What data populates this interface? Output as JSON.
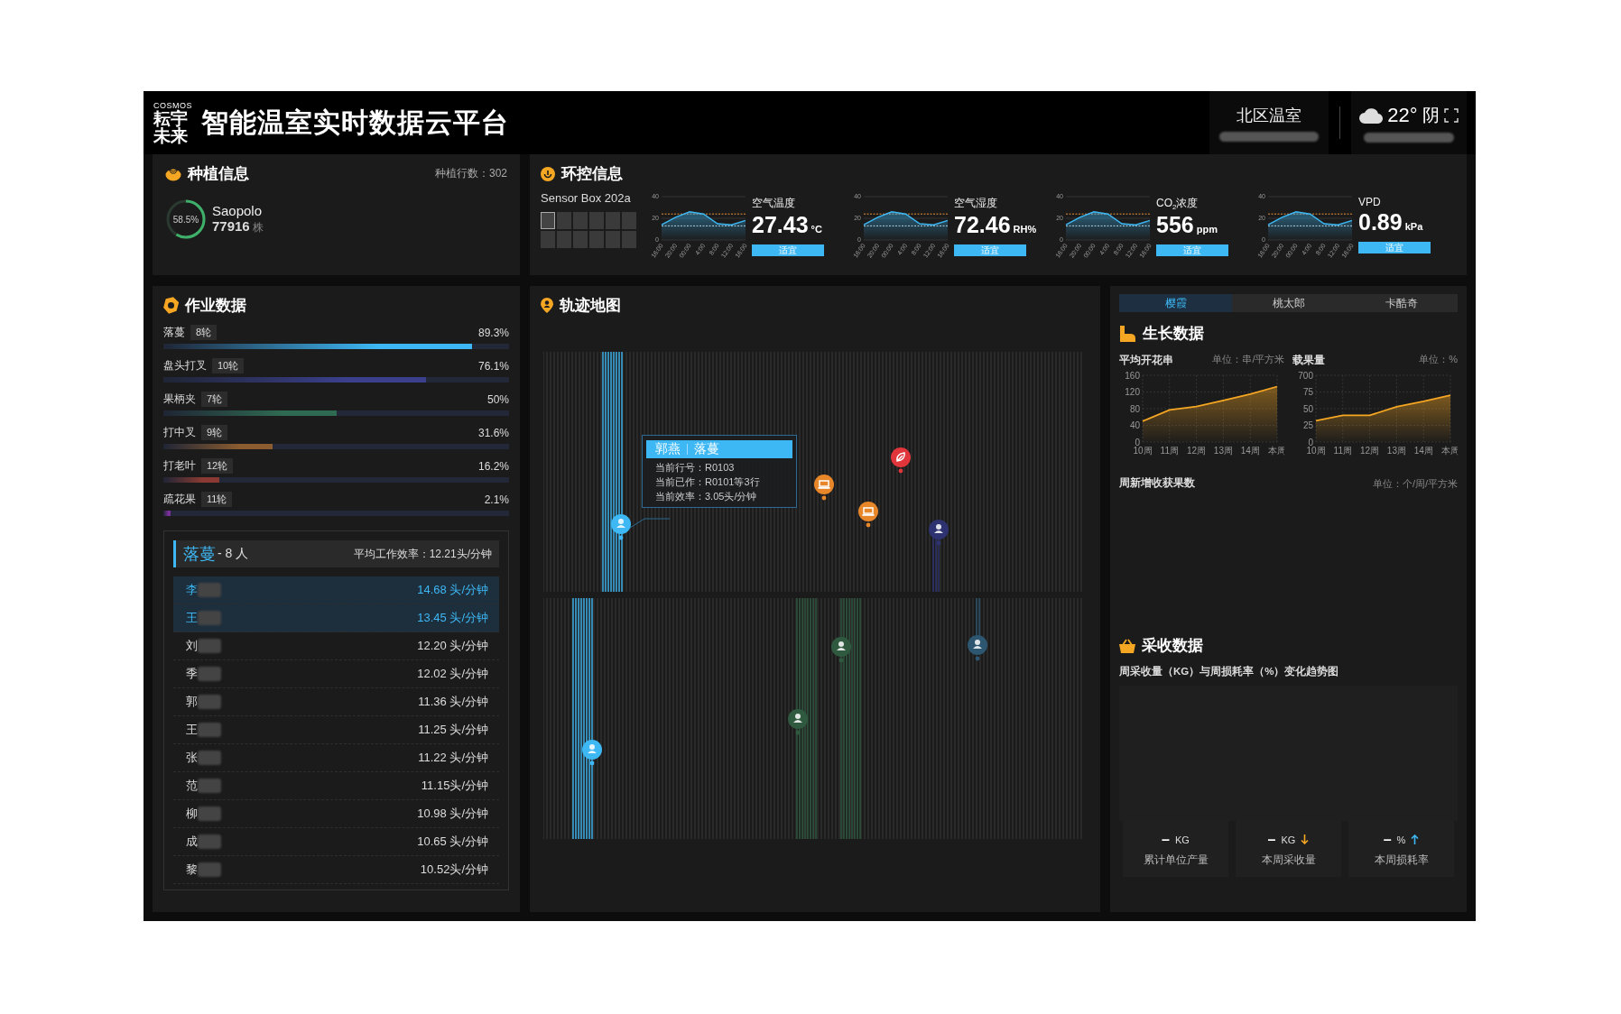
{
  "header": {
    "logo_top": "COSMOS",
    "logo_line_1": "耘宇",
    "logo_line_2": "未来",
    "title": "智能温室实时数据云平台",
    "location": "北区温室",
    "temperature": "22°",
    "weather": "阴"
  },
  "planting": {
    "title": "种植信息",
    "rows_label": "种植行数：302",
    "level": 0.585,
    "percent": "58.5%",
    "variety": "Saopolo",
    "count": "77916",
    "unit": "株"
  },
  "environment": {
    "title": "环控信息",
    "sensor_box": {
      "name": "Sensor Box 202a",
      "cells": [
        {
          "selected": true
        },
        {
          "selected": false
        },
        {
          "selected": false
        },
        {
          "selected": false
        },
        {
          "selected": false
        },
        {
          "selected": false
        },
        {
          "selected": false
        },
        {
          "selected": false
        },
        {
          "selected": false
        },
        {
          "selected": false
        },
        {
          "selected": false
        },
        {
          "selected": false
        }
      ]
    },
    "metrics": [
      {
        "label": "空气温度",
        "value": "27.43",
        "unit": "°C",
        "status": "适宜",
        "chart_data": {
          "type": "area",
          "categories": [
            "16:00",
            "20:00",
            "00:00",
            "4:00",
            "8:00",
            "12:00",
            "16:00"
          ],
          "series": [
            {
              "color": "#3db8f5",
              "values": [
                14,
                21,
                26,
                24,
                15,
                14,
                18
              ]
            }
          ],
          "ylim": [
            0,
            40
          ],
          "yticks": [
            0,
            20,
            40
          ],
          "ref_lines": [
            {
              "axis": "y",
              "value": 24,
              "color": "#e8923a"
            },
            {
              "axis": "y",
              "value": 13,
              "color": "#cfd8e0"
            }
          ]
        }
      },
      {
        "label": "空气湿度",
        "value": "72.46",
        "unit": "RH%",
        "status": "适宜",
        "chart_data": {
          "type": "area",
          "categories": [
            "16:00",
            "20:00",
            "00:00",
            "4:00",
            "8:00",
            "12:00",
            "16:00"
          ],
          "series": [
            {
              "color": "#3db8f5",
              "values": [
                14,
                21,
                26,
                24,
                15,
                14,
                18
              ]
            }
          ],
          "ylim": [
            0,
            40
          ],
          "yticks": [
            0,
            20,
            40
          ],
          "ref_lines": [
            {
              "axis": "y",
              "value": 24,
              "color": "#e8923a"
            },
            {
              "axis": "y",
              "value": 13,
              "color": "#cfd8e0"
            }
          ]
        }
      },
      {
        "label": "CO$_{2}$浓度",
        "value": "556",
        "unit": "ppm",
        "status": "适宜",
        "chart_data": {
          "type": "area",
          "categories": [
            "16:00",
            "20:00",
            "00:00",
            "4:00",
            "8:00",
            "12:00",
            "16:00"
          ],
          "series": [
            {
              "color": "#3db8f5",
              "values": [
                14,
                21,
                26,
                24,
                15,
                14,
                18
              ]
            }
          ],
          "ylim": [
            0,
            40
          ],
          "yticks": [
            0,
            20,
            40
          ],
          "ref_lines": [
            {
              "axis": "y",
              "value": 24,
              "color": "#e8923a"
            },
            {
              "axis": "y",
              "value": 13,
              "color": "#cfd8e0"
            }
          ]
        }
      },
      {
        "label": "VPD",
        "value": "0.89",
        "unit": "kPa",
        "status": "适宜",
        "chart_data": {
          "type": "area",
          "categories": [
            "16:00",
            "20:00",
            "00:00",
            "4:00",
            "8:00",
            "12:00",
            "16:00"
          ],
          "series": [
            {
              "color": "#3db8f5",
              "values": [
                14,
                21,
                26,
                24,
                15,
                14,
                18
              ]
            }
          ],
          "ylim": [
            0,
            40
          ],
          "yticks": [
            0,
            20,
            40
          ],
          "ref_lines": [
            {
              "axis": "y",
              "value": 24,
              "color": "#e8923a"
            },
            {
              "axis": "y",
              "value": 13,
              "color": "#cfd8e0"
            }
          ]
        }
      }
    ]
  },
  "work": {
    "title": "作业数据",
    "operations": [
      {
        "name": "落蔓",
        "rounds": "8轮",
        "percent": "89.3%",
        "level": 0.893,
        "color": "#3db8f5"
      },
      {
        "name": "盘头打叉",
        "rounds": "10轮",
        "percent": "76.1%",
        "level": 0.761,
        "color": "#3b3f8c"
      },
      {
        "name": "果柄夹",
        "rounds": "7轮",
        "percent": "50%",
        "level": 0.5,
        "color": "#2f6b52"
      },
      {
        "name": "打中叉",
        "rounds": "9轮",
        "percent": "31.6%",
        "level": 0.316,
        "color": "#8a5c30"
      },
      {
        "name": "打老叶",
        "rounds": "12轮",
        "percent": "16.2%",
        "level": 0.162,
        "color": "#8a3a32"
      },
      {
        "name": "疏花果",
        "rounds": "11轮",
        "percent": "2.1%",
        "level": 0.021,
        "color": "#7a2f9a"
      }
    ],
    "crew": {
      "task": "落蔓",
      "count": "- 8 人",
      "average": "平均工作效率：12.21头/分钟",
      "workers": [
        {
          "name": "李",
          "rate": "14.68 头/分钟",
          "selected": true
        },
        {
          "name": "王",
          "rate": "13.45 头/分钟",
          "selected": true
        },
        {
          "name": "刘",
          "rate": "12.20 头/分钟",
          "selected": false
        },
        {
          "name": "季",
          "rate": "12.02 头/分钟",
          "selected": false
        },
        {
          "name": "郭",
          "rate": "11.36 头/分钟",
          "selected": false
        },
        {
          "name": "王",
          "rate": "11.25 头/分钟",
          "selected": false
        },
        {
          "name": "张",
          "rate": "11.22 头/分钟",
          "selected": false
        },
        {
          "name": "范",
          "rate": "11.15头/分钟",
          "selected": false
        },
        {
          "name": "柳",
          "rate": "10.98 头/分钟",
          "selected": false
        },
        {
          "name": "成",
          "rate": "10.65 头/分钟",
          "selected": false
        },
        {
          "name": "黎",
          "rate": "10.52头/分钟",
          "selected": false
        }
      ]
    }
  },
  "map": {
    "title": "轨迹地图",
    "pins": [
      {
        "kind": "person",
        "color": "#3db8f5"
      },
      {
        "kind": "device",
        "color": "#e8862a"
      },
      {
        "kind": "device",
        "color": "#e8862a"
      },
      {
        "kind": "plant",
        "color": "#e0353a"
      },
      {
        "kind": "person",
        "color": "#2e3270"
      },
      {
        "kind": "person",
        "color": "#2f5a40"
      },
      {
        "kind": "person",
        "color": "#2d5670"
      },
      {
        "kind": "person",
        "color": "#2f5a40"
      },
      {
        "kind": "person",
        "color": "#3db8f5"
      }
    ],
    "tooltip": {
      "name": "郭燕",
      "task": "落蔓",
      "lines": [
        "当前行号：R0103",
        "当前已作：R0101等3行",
        "当前效率：3.05头/分钟"
      ]
    }
  },
  "varieties": [
    {
      "label": "樱霞",
      "selected": true
    },
    {
      "label": "桃太郎",
      "selected": false
    },
    {
      "label": "卡酷奇",
      "selected": false
    }
  ],
  "growth": {
    "title": "生长数据",
    "charts": [
      {
        "unit": "单位：串/平方米",
        "chart_data": {
          "type": "area",
          "title": "平均开花串",
          "categories": [
            "10周",
            "11周",
            "12周",
            "13周",
            "14周",
            "本周"
          ],
          "series": [
            {
              "color": "#f5a623",
              "values": [
                50,
                77,
                85,
                100,
                115,
                133
              ]
            }
          ],
          "grid": true,
          "ylim": [
            0,
            160
          ],
          "yticks": [
            0,
            40,
            80,
            120,
            160
          ]
        }
      },
      {
        "unit": "单位：%",
        "axis_top_label": "700",
        "chart_data": {
          "type": "area",
          "title": "载果量",
          "categories": [
            "10周",
            "11周",
            "12周",
            "13周",
            "14周",
            "本周"
          ],
          "series": [
            {
              "color": "#f5a623",
              "values": [
                32,
                40,
                40,
                53,
                61,
                70
              ]
            }
          ],
          "grid": true,
          "ylim": [
            0,
            100
          ],
          "yticks": [
            0,
            25,
            50,
            75
          ]
        }
      }
    ],
    "weekly": {
      "title": "周新增收获果数",
      "unit": "单位：个/周/平方米"
    }
  },
  "harvest": {
    "title": "采收数据",
    "subtitle": "周采收量（KG）与周损耗率（%）变化趋势图",
    "stats": [
      {
        "value": "–",
        "unit": "KG",
        "label": "累计单位产量",
        "kind": "plain"
      },
      {
        "value": "–",
        "unit": "KG",
        "label": "本周采收量",
        "kind": "falling"
      },
      {
        "value": "–",
        "unit": "%",
        "label": "本周损耗率",
        "kind": "rising"
      }
    ]
  }
}
